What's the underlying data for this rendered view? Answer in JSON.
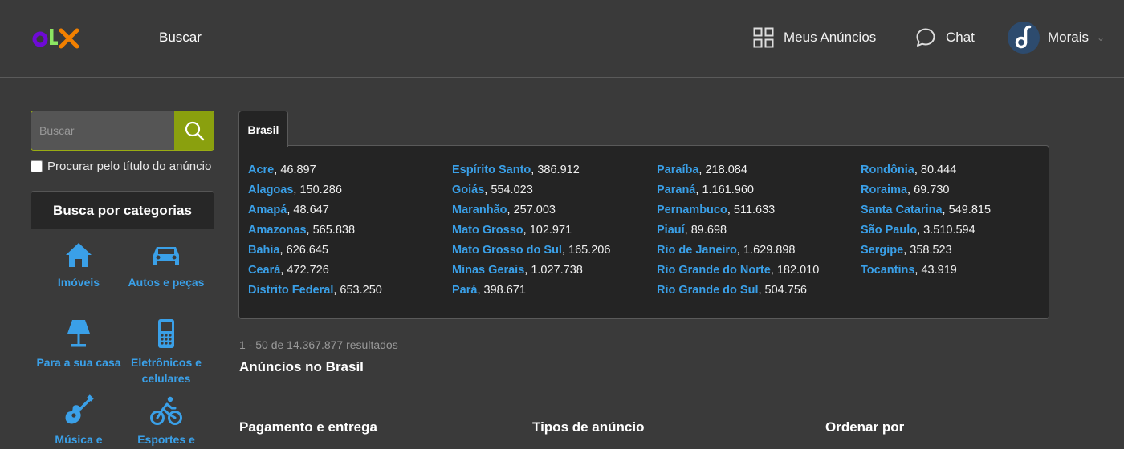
{
  "header": {
    "logo_text": "OLX",
    "search_label": "Buscar",
    "meus_anuncios_label": "Meus Anúncios",
    "chat_label": "Chat",
    "user_name": "Morais"
  },
  "sidebar": {
    "search_placeholder": "Buscar",
    "title_only_label": "Procurar pelo título do anúncio",
    "categories_title": "Busca por categorias",
    "categories": [
      {
        "icon": "house-icon",
        "label": "Imóveis"
      },
      {
        "icon": "car-icon",
        "label": "Autos e peças"
      },
      {
        "icon": "lamp-icon",
        "label": "Para a sua casa"
      },
      {
        "icon": "phone-icon",
        "label": "Eletrônicos e celulares"
      },
      {
        "icon": "guitar-icon",
        "label": "Música e"
      },
      {
        "icon": "bicycle-icon",
        "label": "Esportes e"
      }
    ]
  },
  "regions": {
    "tab_label": "Brasil",
    "columns": [
      [
        {
          "name": "Acre",
          "count": "46.897"
        },
        {
          "name": "Alagoas",
          "count": "150.286"
        },
        {
          "name": "Amapá",
          "count": "48.647"
        },
        {
          "name": "Amazonas",
          "count": "565.838"
        },
        {
          "name": "Bahia",
          "count": "626.645"
        },
        {
          "name": "Ceará",
          "count": "472.726"
        },
        {
          "name": "Distrito Federal",
          "count": "653.250"
        }
      ],
      [
        {
          "name": "Espírito Santo",
          "count": "386.912"
        },
        {
          "name": "Goiás",
          "count": "554.023"
        },
        {
          "name": "Maranhão",
          "count": "257.003"
        },
        {
          "name": "Mato Grosso",
          "count": "102.971"
        },
        {
          "name": "Mato Grosso do Sul",
          "count": "165.206"
        },
        {
          "name": "Minas Gerais",
          "count": "1.027.738"
        },
        {
          "name": "Pará",
          "count": "398.671"
        }
      ],
      [
        {
          "name": "Paraíba",
          "count": "218.084"
        },
        {
          "name": "Paraná",
          "count": "1.161.960"
        },
        {
          "name": "Pernambuco",
          "count": "511.633"
        },
        {
          "name": "Piauí",
          "count": "89.698"
        },
        {
          "name": "Rio de Janeiro",
          "count": "1.629.898"
        },
        {
          "name": "Rio Grande do Norte",
          "count": "182.010"
        },
        {
          "name": "Rio Grande do Sul",
          "count": "504.756"
        }
      ],
      [
        {
          "name": "Rondônia",
          "count": "80.444"
        },
        {
          "name": "Roraima",
          "count": "69.730"
        },
        {
          "name": "Santa Catarina",
          "count": "549.815"
        },
        {
          "name": "São Paulo",
          "count": "3.510.594"
        },
        {
          "name": "Sergipe",
          "count": "358.523"
        },
        {
          "name": "Tocantins",
          "count": "43.919"
        }
      ]
    ]
  },
  "results": {
    "summary": "1 - 50 de 14.367.877 resultados",
    "title": "Anúncios no Brasil"
  },
  "filters": {
    "payment": "Pagamento e entrega",
    "types": "Tipos de anúncio",
    "sort": "Ordenar por"
  },
  "colors": {
    "background": "#3a3a3a",
    "link": "#3aa0e8",
    "search_button": "#8aa00e",
    "panel": "#242424"
  }
}
